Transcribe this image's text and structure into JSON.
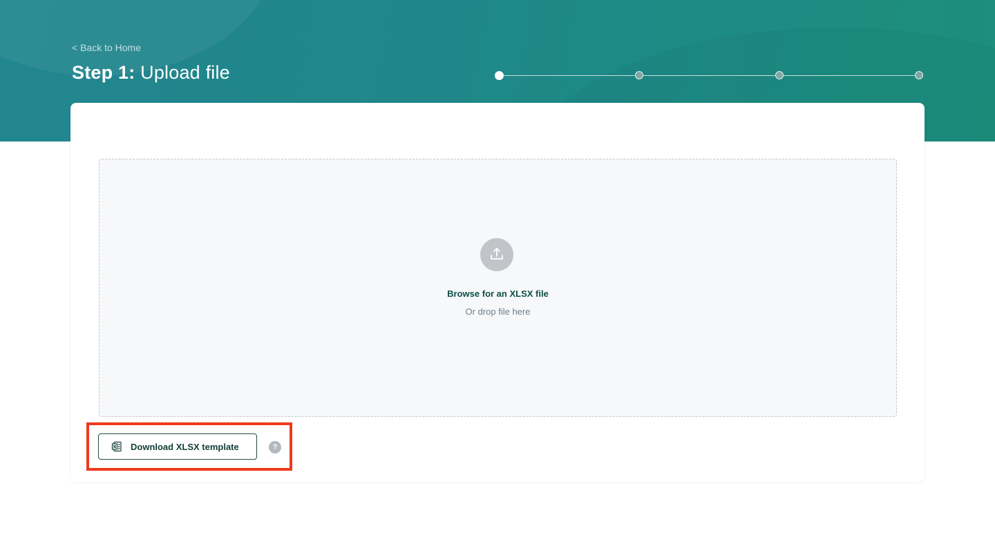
{
  "header": {
    "back_link": "< Back to Home",
    "title_step": "Step 1:",
    "title_text": "Upload file"
  },
  "stepper": {
    "total_steps": 4,
    "current_step": 1
  },
  "dropzone": {
    "browse_label": "Browse for an XLSX file",
    "drop_label": "Or drop file here",
    "icon": "upload-icon"
  },
  "template": {
    "download_label": "Download XLSX template",
    "icon": "excel-file-icon",
    "help_icon": "help-icon",
    "help_glyph": "?"
  },
  "colors": {
    "brand_teal": "#1f8789",
    "dark_green_text": "#0d4f45",
    "highlight_red": "#ee3a1d"
  }
}
